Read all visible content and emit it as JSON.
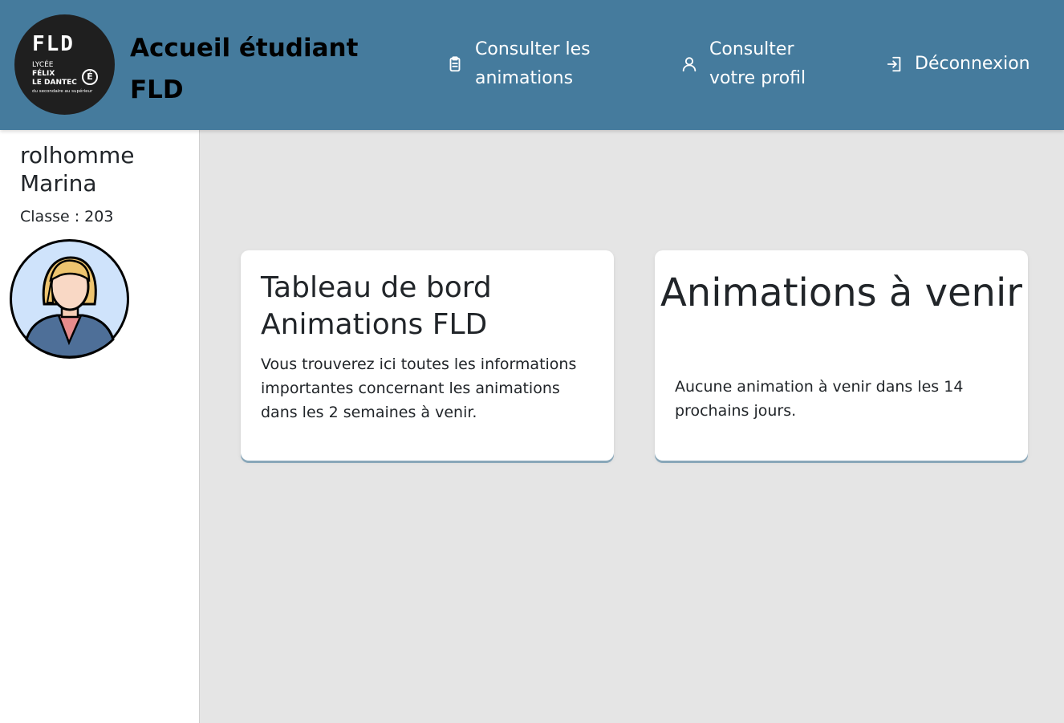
{
  "header": {
    "logo": {
      "mark": "FLD",
      "line1": "LYCÉE",
      "line2": "FÉLIX",
      "line3": "LE DANTEC",
      "line4": "du secondaire au supérieur",
      "badge": "É"
    },
    "title": "Accueil étudiant FLD",
    "nav": [
      {
        "label": "Consulter les animations",
        "icon": "clipboard-icon"
      },
      {
        "label": "Consulter votre profil",
        "icon": "user-icon"
      },
      {
        "label": "Déconnexion",
        "icon": "logout-icon"
      }
    ]
  },
  "sidebar": {
    "user_name": "rolhomme Marina",
    "class_label": "Classe : 203",
    "avatar_icon": "woman-avatar-icon"
  },
  "cards": [
    {
      "title": "Tableau de bord Animations FLD",
      "text": "Vous trouverez ici toutes les informations importantes concernant les animations dans les 2 semaines à venir."
    },
    {
      "title": "Animations à venir",
      "text": "Aucune animation à venir dans les 14 prochains jours."
    }
  ],
  "colors": {
    "header_bg": "#457b9d",
    "page_bg": "#e5e5e5",
    "card_bg": "#ffffff",
    "text": "#212529"
  }
}
